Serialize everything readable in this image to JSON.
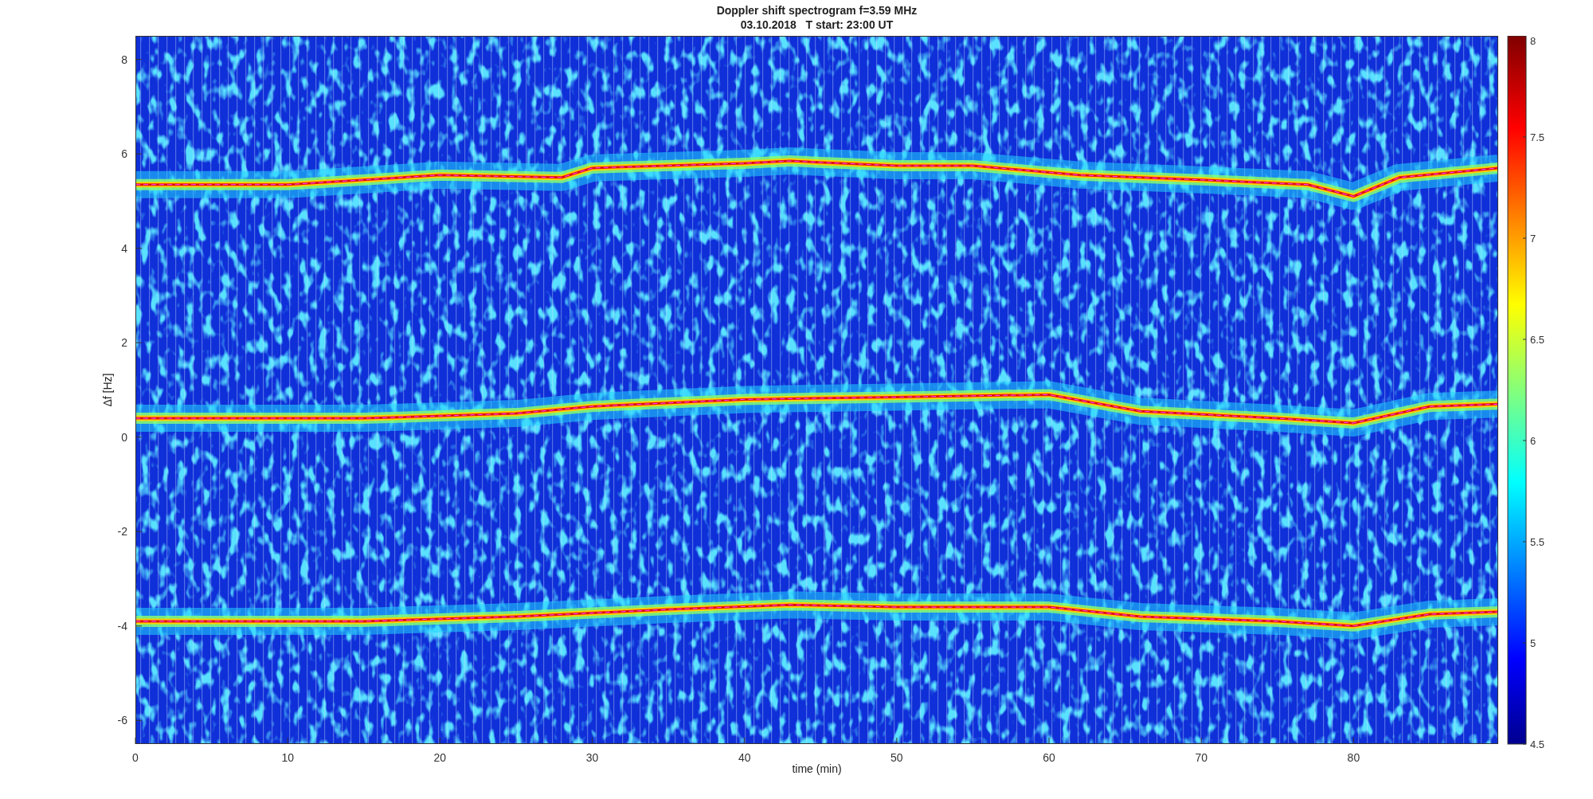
{
  "figure": {
    "title": "Doppler shift spectrogram f=3.59 MHz",
    "subtitle": "03.10.2018   T start: 23:00 UT",
    "xlabel": "time (min)",
    "ylabel": "Δf [Hz]",
    "xticks": [
      "0",
      "10",
      "20",
      "30",
      "40",
      "50",
      "60",
      "70",
      "80"
    ],
    "yticks": [
      "8",
      "6",
      "4",
      "2",
      "0",
      "-2",
      "-4",
      "-6"
    ],
    "colorbar_ticks": [
      "8",
      "7.5",
      "7",
      "6.5",
      "6",
      "5.5",
      "5",
      "4.5"
    ]
  }
}
